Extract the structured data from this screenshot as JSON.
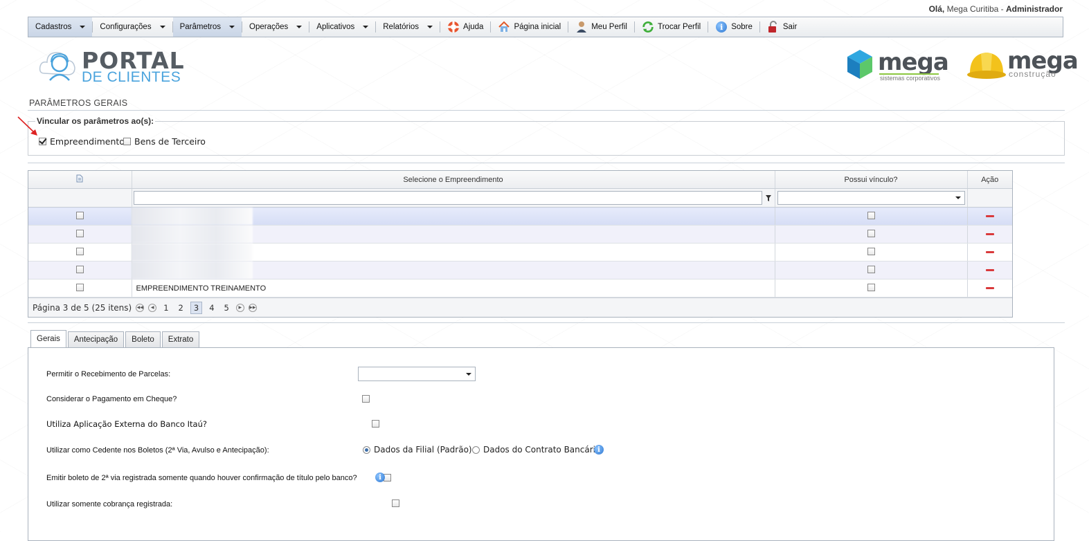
{
  "header": {
    "greeting_prefix": "Olá,",
    "greeting_user": "Mega Curitiba",
    "greeting_sep": " - ",
    "greeting_role": "Administrador"
  },
  "menu": {
    "cadastros": "Cadastros",
    "configuracoes": "Configurações",
    "parametros": "Parâmetros",
    "operacoes": "Operações",
    "aplicativos": "Aplicativos",
    "relatorios": "Relatórios",
    "ajuda": "Ajuda",
    "pagina_inicial": "Página inicial",
    "meu_perfil": "Meu Perfil",
    "trocar_perfil": "Trocar Perfil",
    "sobre": "Sobre",
    "sair": "Sair"
  },
  "logos": {
    "portal_title": "PORTAL",
    "portal_sub": "DE CLIENTES",
    "mega1_word": "mega",
    "mega1_sub": "sistemas corporativos",
    "mega2_word": "mega",
    "mega2_sub": "construção"
  },
  "page": {
    "section_title": "PARÂMETROS GERAIS",
    "link_legend": "Vincular os parâmetros ao(s):",
    "opt_empreendimento": "Empreendimento",
    "opt_bens": "Bens de Terceiro"
  },
  "grid": {
    "col_select": "Selecione o Empreendimento",
    "col_vinculo": "Possui vínculo?",
    "col_acao": "Ação",
    "rows": [
      {
        "name": ""
      },
      {
        "name": ""
      },
      {
        "name": ""
      },
      {
        "name": ""
      },
      {
        "name": "EMPREENDIMENTO TREINAMENTO"
      }
    ],
    "pager_text": "Página 3 de 5 (25 itens)",
    "pages": [
      "1",
      "2",
      "3",
      "4",
      "5"
    ]
  },
  "tabs": {
    "gerais": "Gerais",
    "antecipacao": "Antecipação",
    "boleto": "Boleto",
    "extrato": "Extrato"
  },
  "form": {
    "permitir": "Permitir o Recebimento de Parcelas:",
    "cheque": "Considerar o Pagamento em Cheque?",
    "itau": "Utiliza Aplicação Externa do Banco Itaú?",
    "cedente": "Utilizar como Cedente nos Boletos (2ª Via, Avulso e Antecipação):",
    "radio_filial": "Dados da Filial (Padrão)",
    "radio_contrato": "Dados do Contrato Bancário",
    "emitir": "Emitir boleto de 2ª via registrada somente quando houver confirmação de título pelo banco?",
    "cobranca": "Utilizar somente cobrança registrada:"
  },
  "colors": {
    "accent": "#4aa3dd",
    "menu_active": "#c9d5e6",
    "action_red": "#d9393b"
  }
}
